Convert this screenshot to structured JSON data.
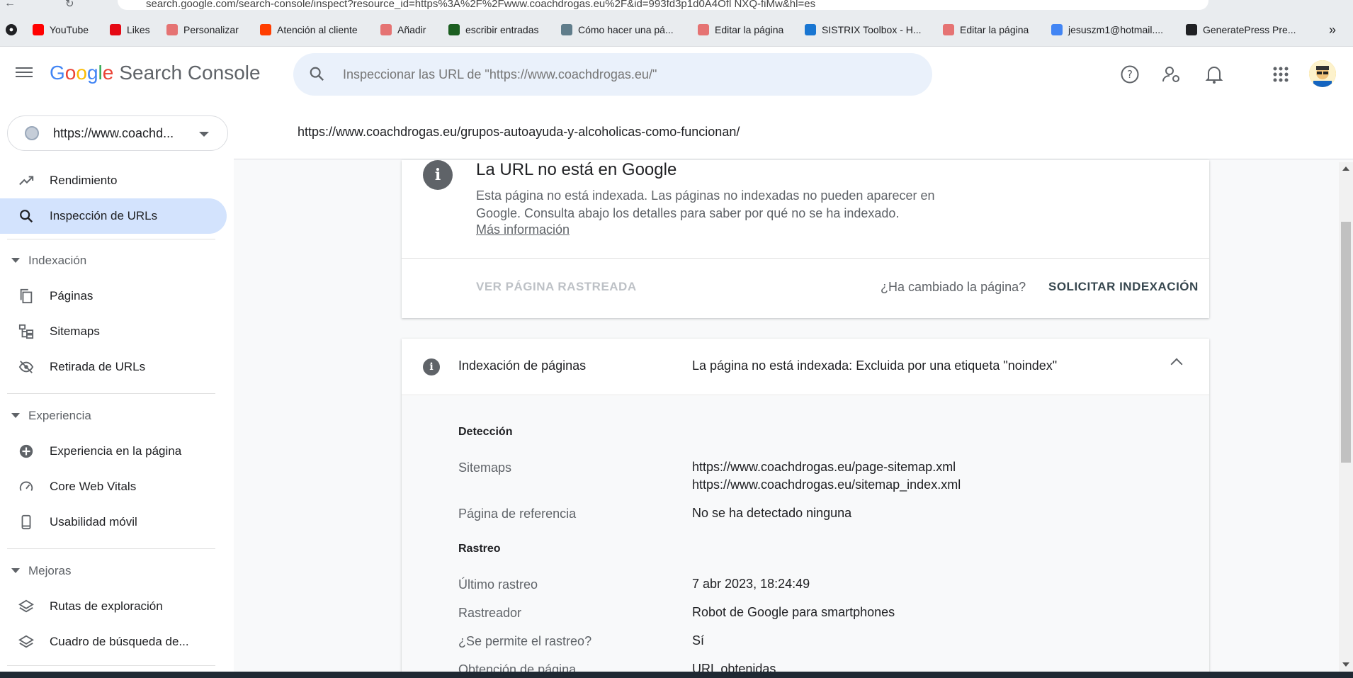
{
  "browser": {
    "url": "search.google.com/search-console/inspect?resource_id=https%3A%2F%2Fwww.coachdrogas.eu%2F&id=993fd3p1d0A4Ofl NXQ-fiMw&hl=es",
    "bookmarks": [
      {
        "label": "YouTube",
        "icon": "youtube-icon",
        "color": "#ff0000"
      },
      {
        "label": "Likes",
        "icon": "netflix-icon",
        "color": "#e50914"
      },
      {
        "label": "Personalizar",
        "icon": "page-icon",
        "color": "#e57373"
      },
      {
        "label": "Atención al cliente",
        "icon": "brand-icon",
        "color": "#ff3d00"
      },
      {
        "label": "Añadir",
        "icon": "page-icon",
        "color": "#e57373"
      },
      {
        "label": "escribir entradas",
        "icon": "dollar-icon",
        "color": "#1b5e20"
      },
      {
        "label": "Cómo hacer una pá...",
        "icon": "image-icon",
        "color": "#607d8b"
      },
      {
        "label": "Editar la página",
        "icon": "page-icon",
        "color": "#e57373"
      },
      {
        "label": "SISTRIX Toolbox - H...",
        "icon": "magnifier-icon",
        "color": "#1976d2"
      },
      {
        "label": "Editar la página",
        "icon": "page-icon",
        "color": "#e57373"
      },
      {
        "label": "jesuszm1@hotmail....",
        "icon": "google-icon",
        "color": "#4285f4"
      },
      {
        "label": "GeneratePress Pre...",
        "icon": "globe-icon",
        "color": "#202124"
      }
    ],
    "more": "»"
  },
  "header": {
    "logo_google": [
      "G",
      "o",
      "o",
      "g",
      "l",
      "e"
    ],
    "logo_product": "Search Console",
    "search_placeholder": "Inspeccionar las URL de \"https://www.coachdrogas.eu/\""
  },
  "sidebar": {
    "property": "https://www.coachd...",
    "items_top": [
      {
        "label": "Rendimiento",
        "icon": "trending-up-icon"
      },
      {
        "label": "Inspección de URLs",
        "icon": "search-icon",
        "active": true
      }
    ],
    "sections": [
      {
        "title": "Indexación",
        "items": [
          {
            "label": "Páginas",
            "icon": "pages-icon"
          },
          {
            "label": "Sitemaps",
            "icon": "sitemap-icon"
          },
          {
            "label": "Retirada de URLs",
            "icon": "eye-off-icon"
          }
        ]
      },
      {
        "title": "Experiencia",
        "items": [
          {
            "label": "Experiencia en la página",
            "icon": "plus-circle-icon"
          },
          {
            "label": "Core Web Vitals",
            "icon": "gauge-icon"
          },
          {
            "label": "Usabilidad móvil",
            "icon": "phone-icon"
          }
        ]
      },
      {
        "title": "Mejoras",
        "items": [
          {
            "label": "Rutas de exploración",
            "icon": "layers-icon"
          },
          {
            "label": "Cuadro de búsqueda de...",
            "icon": "layers-icon"
          }
        ]
      }
    ]
  },
  "main": {
    "inspected_url": "https://www.coachdrogas.eu/grupos-autoayuda-y-alcoholicas-como-funcionan/",
    "status_card": {
      "title": "La URL no está en Google",
      "description": "Esta página no está indexada. Las páginas no indexadas no pueden aparecer en Google. Consulta abajo los detalles para saber por qué no se ha indexado.",
      "more": "Más información",
      "view_crawled": "VER PÁGINA RASTREADA",
      "changed_q": "¿Ha cambiado la página?",
      "request_index": "SOLICITAR INDEXACIÓN"
    },
    "indexing_card": {
      "label": "Indexación de páginas",
      "value": "La página no está indexada: Excluida por una etiqueta \"noindex\"",
      "detection_title": "Detección",
      "sitemaps_key": "Sitemaps",
      "sitemaps": [
        "https://www.coachdrogas.eu/page-sitemap.xml",
        "https://www.coachdrogas.eu/sitemap_index.xml"
      ],
      "referring_key": "Página de referencia",
      "referring_val": "No se ha detectado ninguna",
      "crawl_title": "Rastreo",
      "last_crawl_key": "Último rastreo",
      "last_crawl_val": "7 abr 2023, 18:24:49",
      "crawler_key": "Rastreador",
      "crawler_val": "Robot de Google para smartphones",
      "allowed_key": "¿Se permite el rastreo?",
      "allowed_val": "Sí",
      "fetch_key": "Obtención de página",
      "fetch_val": "URL obtenidas"
    }
  },
  "colors": {
    "accent": "#1a73e8",
    "active_bg": "#d3e3fd",
    "request_btn": "#37474f"
  }
}
